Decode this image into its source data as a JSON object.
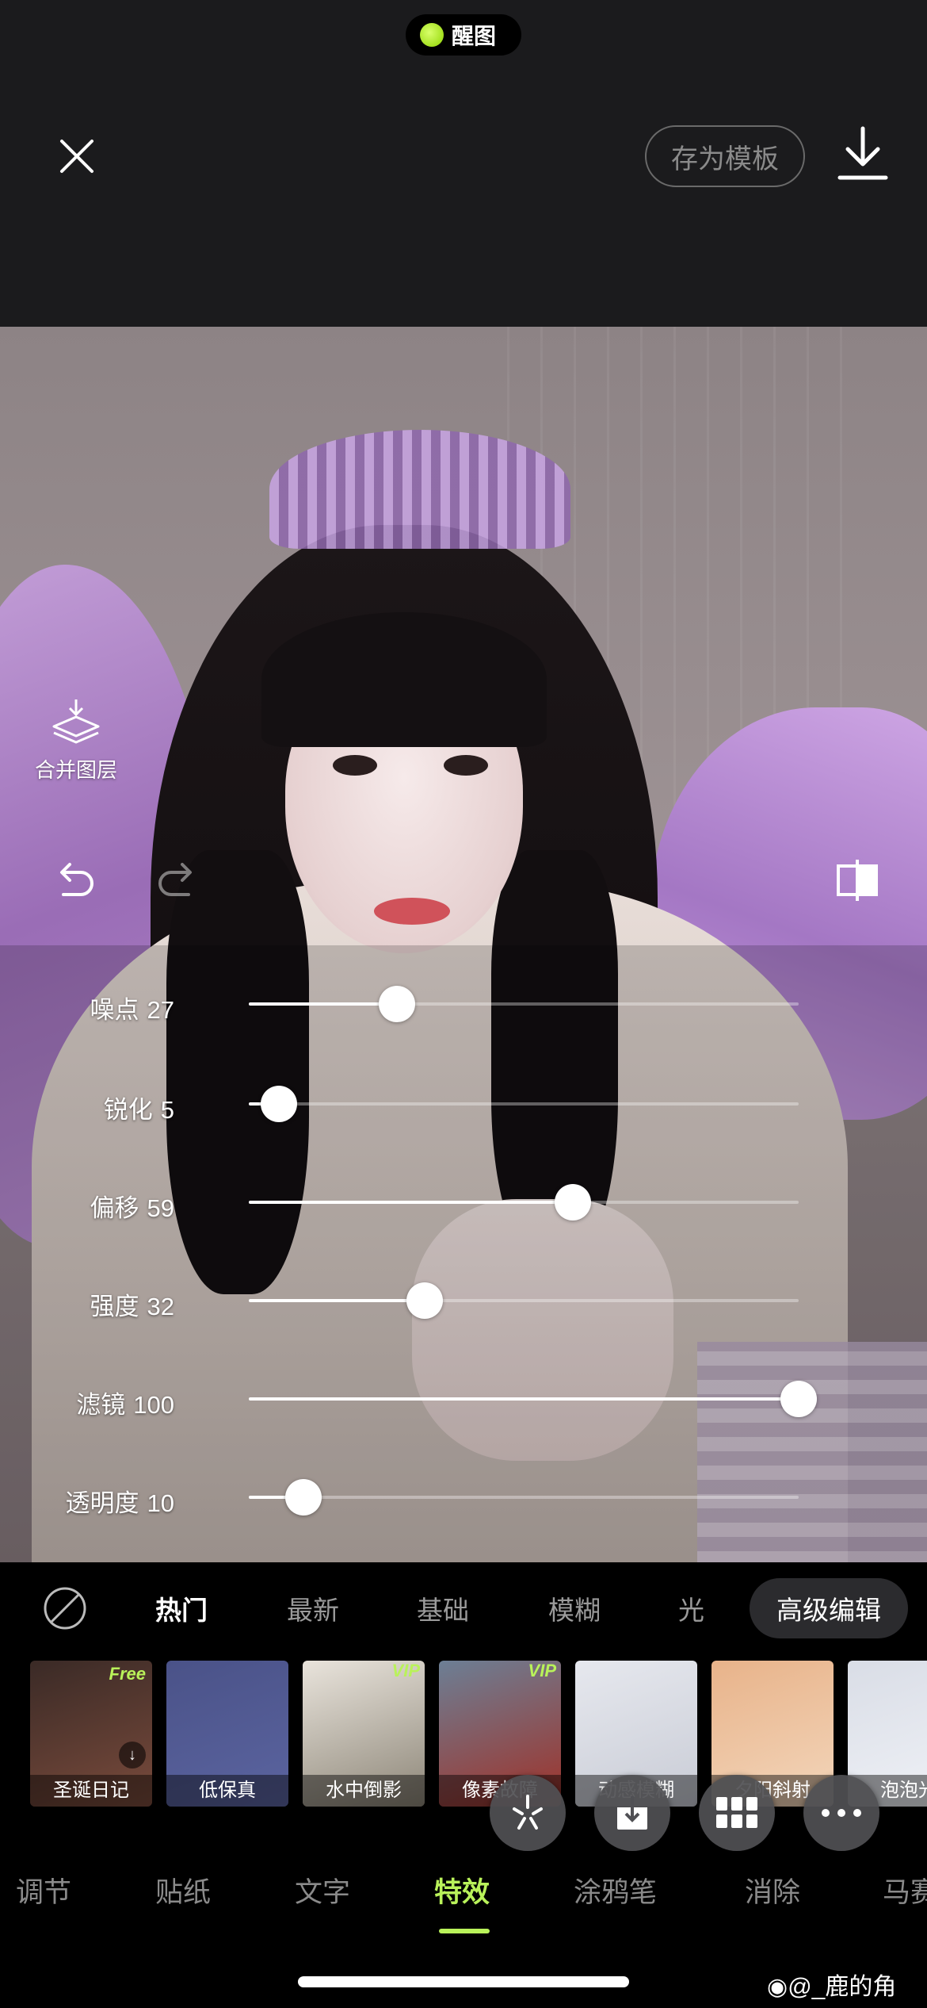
{
  "status": {
    "app_pill_label": "醒图"
  },
  "header": {
    "save_template_label": "存为模板"
  },
  "canvas": {
    "merge_layers_label": "合并图层"
  },
  "sliders": [
    {
      "name": "噪点",
      "value": 27,
      "max": 100
    },
    {
      "name": "锐化",
      "value": 5,
      "max": 100
    },
    {
      "name": "偏移",
      "value": 59,
      "max": 100
    },
    {
      "name": "强度",
      "value": 32,
      "max": 100
    },
    {
      "name": "滤镜",
      "value": 100,
      "max": 100
    },
    {
      "name": "透明度",
      "value": 10,
      "max": 100
    }
  ],
  "categories": [
    {
      "label": "热门",
      "active": true
    },
    {
      "label": "最新"
    },
    {
      "label": "基础"
    },
    {
      "label": "模糊"
    },
    {
      "label": "光"
    },
    {
      "label": "高级编辑",
      "selected_pill": true
    }
  ],
  "effects": [
    {
      "label": "圣诞日记",
      "badge": "Free",
      "downloadable": true,
      "colors": [
        "#3a2a26",
        "#7a4b3c"
      ]
    },
    {
      "label": "低保真",
      "colors": [
        "#4a5288",
        "#5b64a0"
      ]
    },
    {
      "label": "水中倒影",
      "badge": "VIP",
      "colors": [
        "#e9e4dc",
        "#8d8678"
      ]
    },
    {
      "label": "像素故障",
      "badge": "VIP",
      "colors": [
        "#6c7f95",
        "#a03128"
      ]
    },
    {
      "label": "动感模糊",
      "colors": [
        "#e6e8ee",
        "#c9ccd6"
      ]
    },
    {
      "label": "夕阳斜射",
      "colors": [
        "#e8b38a",
        "#f3d6bb"
      ]
    },
    {
      "label": "泡泡光",
      "colors": [
        "#d9dde6",
        "#f0f2f7"
      ]
    }
  ],
  "floating_actions": [
    {
      "icon": "sparkle-icon"
    },
    {
      "icon": "download-box-icon"
    },
    {
      "icon": "grid-icon"
    },
    {
      "icon": "more-icon"
    }
  ],
  "bottom_tabs": [
    {
      "label": "调节"
    },
    {
      "label": "贴纸"
    },
    {
      "label": "文字"
    },
    {
      "label": "特效",
      "active": true
    },
    {
      "label": "涂鸦笔"
    },
    {
      "label": "消除"
    },
    {
      "label": "马赛克"
    }
  ],
  "watermark": "@_鹿的角",
  "colors": {
    "accent": "#b9f25a",
    "background": "#000000",
    "header": "#1b1b1d"
  }
}
